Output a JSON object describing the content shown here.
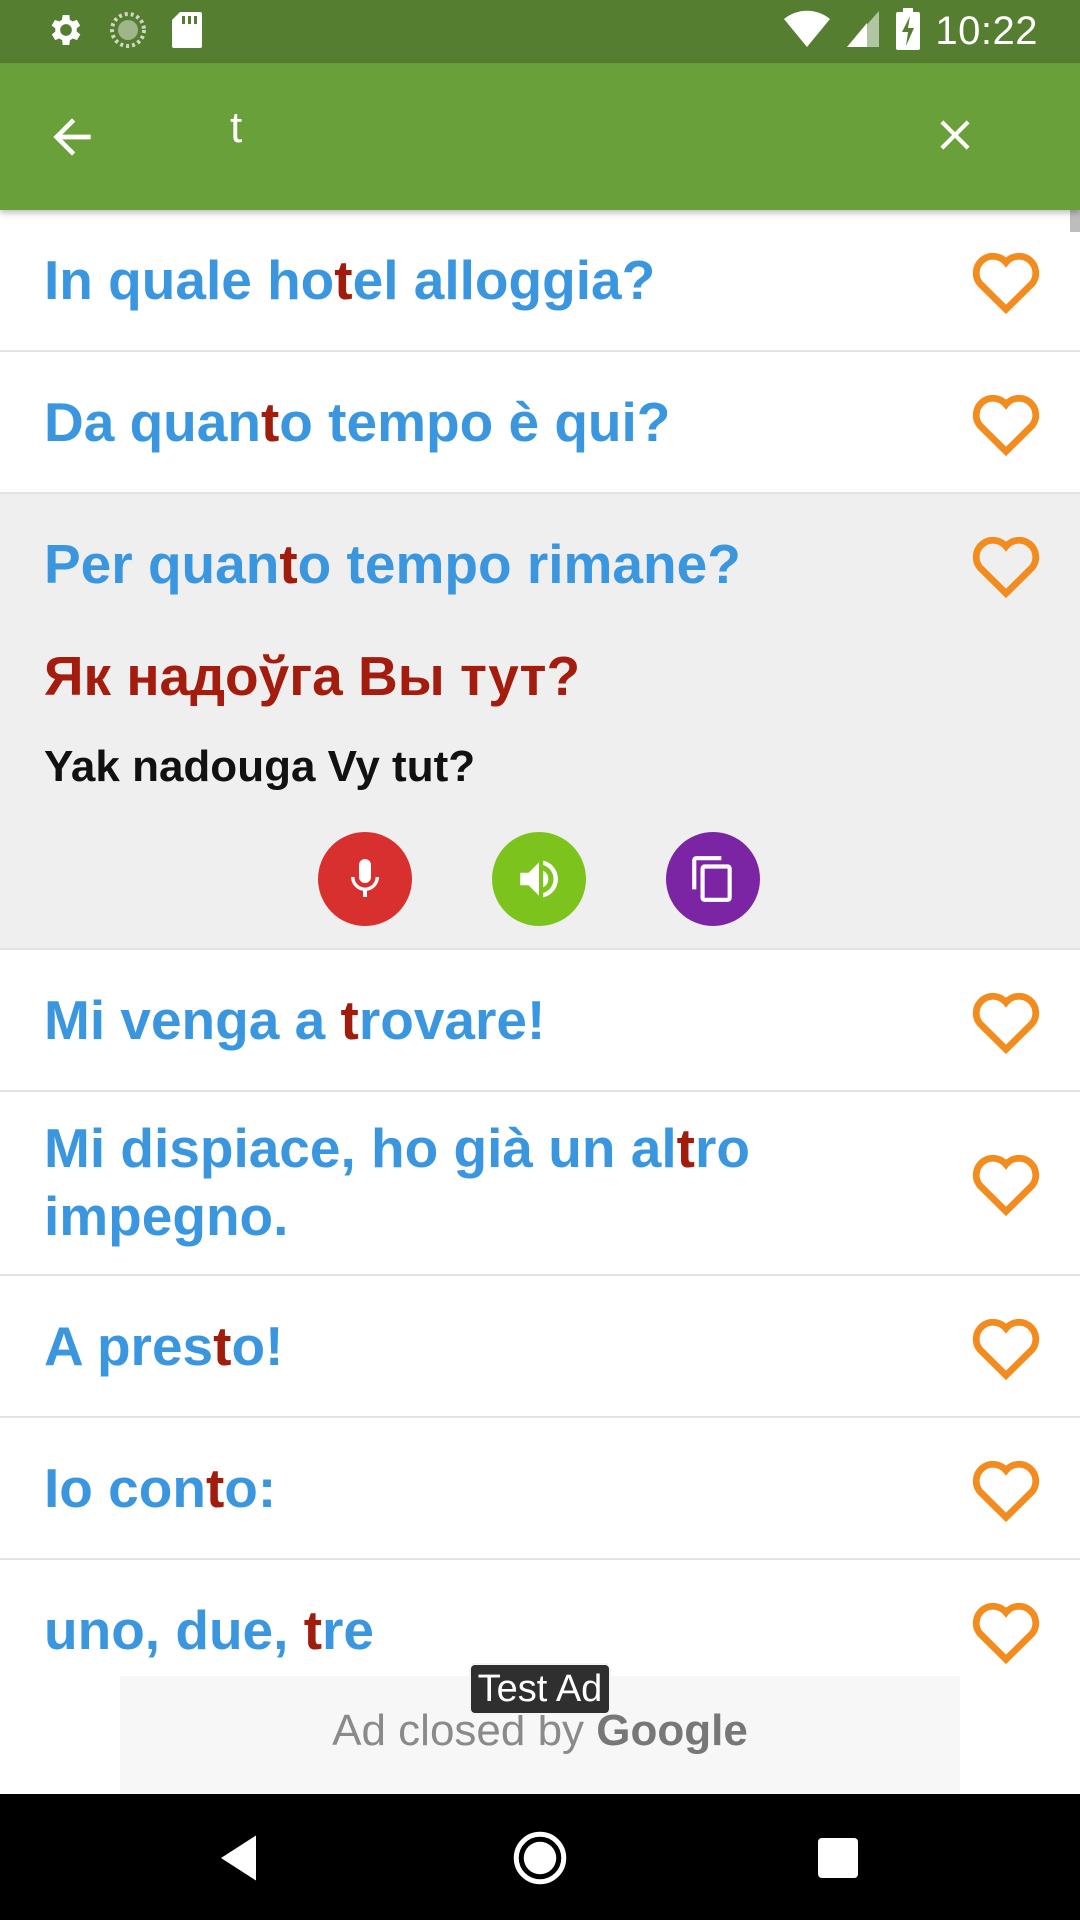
{
  "status_bar": {
    "time": "10:22",
    "icons": [
      "settings-icon",
      "loading-icon",
      "sd-card-icon",
      "wifi-icon",
      "signal-icon",
      "battery-charging-icon"
    ]
  },
  "search_bar": {
    "query": "t",
    "back_icon": "arrow-left-icon",
    "clear_icon": "close-icon"
  },
  "colors": {
    "status_bar": "#557e31",
    "app_bar": "#6aa03a",
    "phrase": "#3a97df",
    "highlight": "#a01c0c",
    "heart": "#f28c1e",
    "mic_button": "#d8302f",
    "speaker_button": "#7cc31e",
    "copy_button": "#7b25a5"
  },
  "phrases": [
    {
      "pre": "In quale ho",
      "match": "t",
      "post": "el alloggia?"
    },
    {
      "pre": "Da quan",
      "match": "t",
      "post": "o tempo è qui?"
    },
    {
      "pre": "Per quan",
      "match": "t",
      "post": "o tempo rimane?"
    },
    {
      "pre": "Mi venga a ",
      "match": "t",
      "post": "rovare!"
    },
    {
      "pre": "Mi dispiace, ho già un al",
      "match": "t",
      "post": "ro impegno."
    },
    {
      "pre": "A pres",
      "match": "t",
      "post": "o!"
    },
    {
      "pre": "Io con",
      "match": "t",
      "post": "o:"
    },
    {
      "pre": "uno, due, ",
      "match": "t",
      "post": "re"
    }
  ],
  "expanded": {
    "translation": "Як надоўга Вы тут?",
    "transliteration": "Yak nadouga Vy tut?",
    "actions": [
      "mic-icon",
      "speaker-icon",
      "copy-icon"
    ]
  },
  "ad": {
    "badge": "Test Ad",
    "closed_text": "Ad closed by",
    "brand": "Google"
  },
  "nav": [
    "back-triangle-icon",
    "home-circle-icon",
    "recents-square-icon"
  ]
}
